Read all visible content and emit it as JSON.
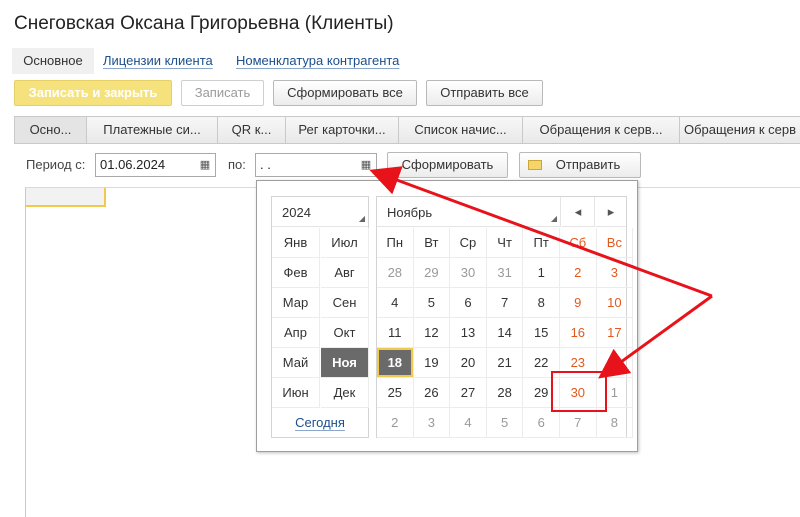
{
  "window": {
    "title": "Снеговская Оксана Григорьевна (Клиенты)"
  },
  "top_tabs": [
    {
      "label": "Основное"
    },
    {
      "label": "Лицензии клиента"
    },
    {
      "label": "Номенклатура контрагента"
    }
  ],
  "toolbar": {
    "save_close": "Записать и закрыть",
    "save": "Записать",
    "form_all": "Сформировать все",
    "send_all": "Отправить все"
  },
  "sub_tabs": [
    "Осно...",
    "Платежные си...",
    "QR к...",
    "Рег карточки...",
    "Список начис...",
    "Обращения к серв...",
    "Обращения к серв"
  ],
  "period": {
    "from_label": "Период с:",
    "from_value": "01.06.2024",
    "to_label": "по:",
    "to_value": " .  .",
    "form_button": "Сформировать",
    "send_button": "Отправить"
  },
  "calendar": {
    "year": "2024",
    "month": "Ноябрь",
    "prev": "◂",
    "next": "▸",
    "months": [
      [
        "Янв",
        "Июл"
      ],
      [
        "Фев",
        "Авг"
      ],
      [
        "Мар",
        "Сен"
      ],
      [
        "Апр",
        "Окт"
      ],
      [
        "Май",
        "Ноя"
      ],
      [
        "Июн",
        "Дек"
      ]
    ],
    "selected_month": "Ноя",
    "today_label": "Сегодня",
    "weekdays": [
      "Пн",
      "Вт",
      "Ср",
      "Чт",
      "Пт",
      "Сб",
      "Вс"
    ],
    "weeks": [
      [
        "28",
        "29",
        "30",
        "31",
        "1",
        "2",
        "3"
      ],
      [
        "4",
        "5",
        "6",
        "7",
        "8",
        "9",
        "10"
      ],
      [
        "11",
        "12",
        "13",
        "14",
        "15",
        "16",
        "17"
      ],
      [
        "18",
        "19",
        "20",
        "21",
        "22",
        "23",
        "24"
      ],
      [
        "25",
        "26",
        "27",
        "28",
        "29",
        "30",
        "1"
      ],
      [
        "2",
        "3",
        "4",
        "5",
        "6",
        "7",
        "8"
      ]
    ],
    "today_day": "18",
    "highlighted_day": "30"
  },
  "colors": {
    "accent": "#f6e27d",
    "weekend": "#e05a1e",
    "annotation": "#e8121b",
    "link": "#1c4f8c"
  }
}
